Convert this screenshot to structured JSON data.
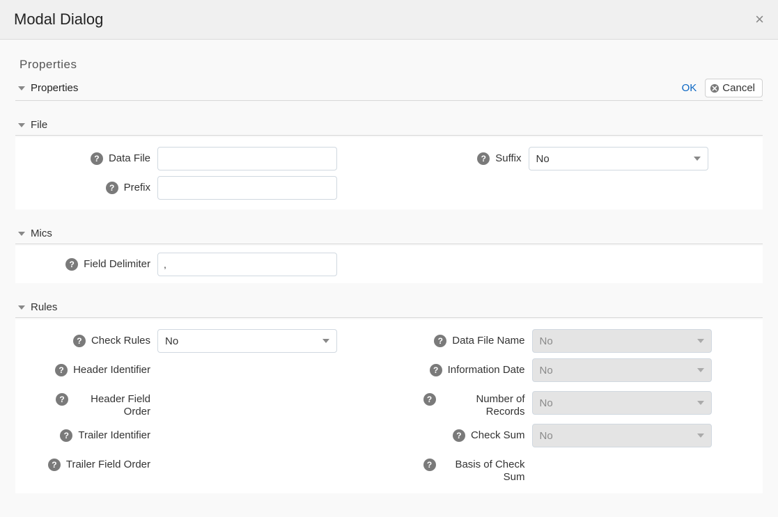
{
  "modal": {
    "title": "Modal Dialog",
    "close_glyph": "×"
  },
  "page": {
    "title": "Properties",
    "ok": "OK",
    "cancel": "Cancel"
  },
  "sections": {
    "properties": {
      "title": "Properties"
    },
    "file": {
      "title": "File",
      "data_file": {
        "label": "Data File",
        "value": ""
      },
      "prefix": {
        "label": "Prefix",
        "value": ""
      },
      "suffix": {
        "label": "Suffix",
        "value": "No"
      }
    },
    "mics": {
      "title": "Mics",
      "field_delimiter": {
        "label": "Field Delimiter",
        "value": ","
      }
    },
    "rules": {
      "title": "Rules",
      "check_rules": {
        "label": "Check Rules",
        "value": "No"
      },
      "header_identifier": {
        "label": "Header Identifier"
      },
      "header_field_order": {
        "label": "Header Field Order"
      },
      "trailer_identifier": {
        "label": "Trailer Identifier"
      },
      "trailer_field_order": {
        "label": "Trailer Field Order"
      },
      "data_file_name": {
        "label": "Data File Name",
        "value": "No"
      },
      "information_date": {
        "label": "Information Date",
        "value": "No"
      },
      "number_of_records": {
        "label": "Number of Records",
        "value": "No"
      },
      "check_sum": {
        "label": "Check Sum",
        "value": "No"
      },
      "basis_of_check_sum": {
        "label": "Basis of Check Sum"
      }
    }
  },
  "help_glyph": "?"
}
